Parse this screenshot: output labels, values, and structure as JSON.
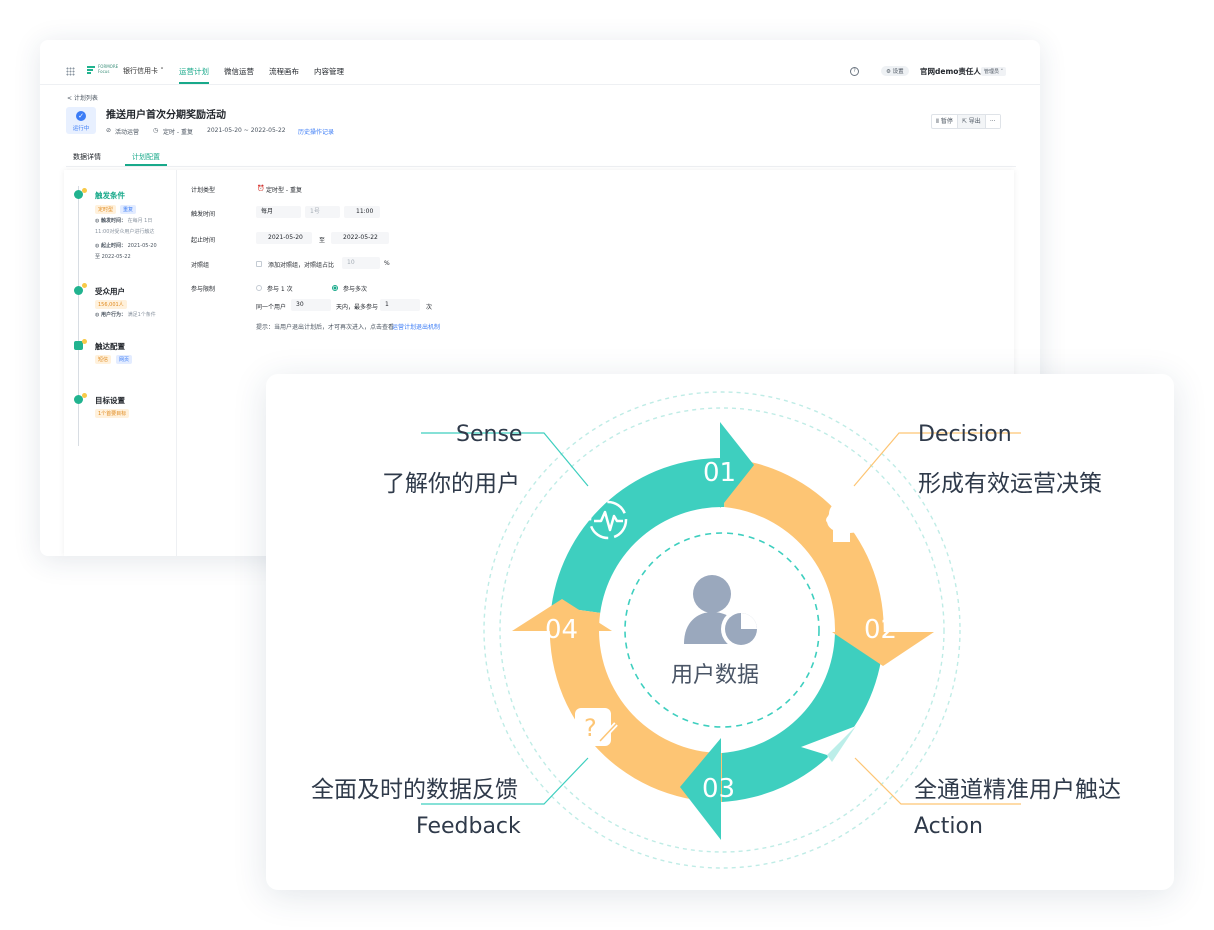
{
  "app": {
    "logo_text": "FORMORE Focus",
    "org_select": "银行信用卡 ˅",
    "nav": [
      "运营计划",
      "微信运营",
      "流程画布",
      "内容管理"
    ],
    "help_icon": "?",
    "settings_label": "⚙ 设置",
    "user_name": "官网demo责任人",
    "user_role": "管理员 ˅"
  },
  "plan": {
    "back_label": "< 计划列表",
    "status": "运行中",
    "title": "推送用户首次分期奖励活动",
    "category": "活动运营",
    "schedule_type": "定时 - 重复",
    "date_range": "2021-05-20 ~ 2022-05-22",
    "history_link": "历史操作记录",
    "actions": [
      "Ⅱ 暂停",
      "⇱ 导出",
      "···"
    ],
    "tabs": [
      "数据详情",
      "计划配置"
    ]
  },
  "steps": [
    {
      "title": "触发条件",
      "tags": [
        "定时型",
        "重复"
      ],
      "detail_1_label": "触发时间：",
      "detail_1_value": "在每月 1日",
      "detail_1_cont": "11:00对受众用户进行触达",
      "detail_2_label": "起止时间：",
      "detail_2_value": "2021-05-20",
      "detail_2_cont": "至 2022-05-22"
    },
    {
      "title": "受众用户",
      "tags": [
        "156,001人"
      ],
      "detail_label": "用户行为：",
      "detail_value": "满足1个条件"
    },
    {
      "title": "触达配置",
      "tags": [
        "短信",
        "网页"
      ]
    },
    {
      "title": "目标设置",
      "tags": [
        "1个首要目标"
      ]
    }
  ],
  "form": {
    "plan_type_label": "计划类型",
    "plan_type_value": "定时型 - 重复",
    "trigger_label": "触发时间",
    "trigger_freq": "每月",
    "trigger_day": "1号",
    "trigger_time": "11:00",
    "range_label": "起止时间",
    "range_start": "2021-05-20",
    "range_to": "至",
    "range_end": "2022-05-22",
    "control_label": "对照组",
    "control_text": "添加对照组，对照组占比",
    "control_value": "10",
    "control_unit": "%",
    "limit_label": "参与限制",
    "limit_opt1": "参与 1 次",
    "limit_opt2": "参与多次",
    "same_user": "同一个用户",
    "days_value": "30",
    "days_text": "天内，最多参与",
    "times_value": "1",
    "times_unit": "次",
    "hint_text": "提示：当用户退出计划后，才可再次进入，点击查看",
    "hint_link": "运营计划退出机制"
  },
  "diagram": {
    "center_label": "用户数据",
    "steps": [
      {
        "number": "01",
        "en": "Sense",
        "cn": "了解你的用户"
      },
      {
        "number": "02",
        "en": "Decision",
        "cn": "形成有效运营决策"
      },
      {
        "number": "03",
        "en": "Action",
        "cn": "全通道精准用户触达"
      },
      {
        "number": "04",
        "en": "Feedback",
        "cn": "全面及时的数据反馈"
      }
    ],
    "colors": {
      "teal": "#3ecfbf",
      "orange": "#fdc574",
      "text": "#2f3a4a",
      "icon_gray": "#9aa8bd"
    },
    "icons": [
      "pulse-icon",
      "brain-head-icon",
      "paper-plane-icon",
      "question-note-icon",
      "user-chart-icon"
    ]
  }
}
